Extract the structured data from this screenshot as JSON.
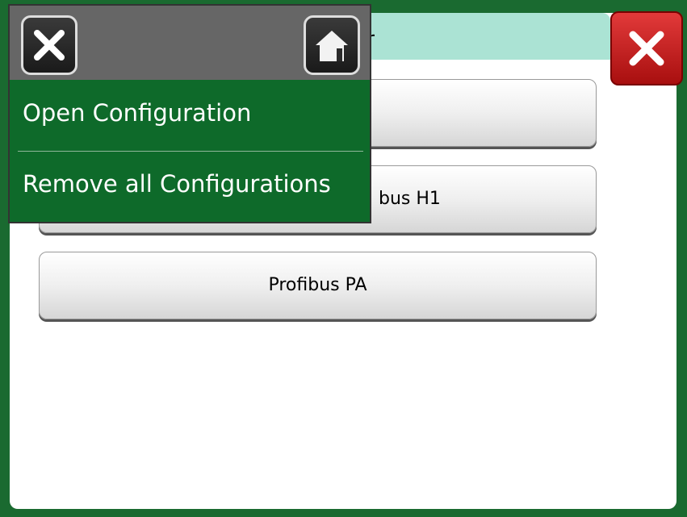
{
  "window": {
    "title_visible": "tor",
    "close_icon": "close-icon"
  },
  "main": {
    "buttons": [
      {
        "label": ""
      },
      {
        "label": "bus H1"
      },
      {
        "label": "Profibus PA"
      }
    ]
  },
  "menu": {
    "close_icon": "close-icon",
    "home_icon": "home-icon",
    "items": [
      {
        "label": "Open Configuration"
      },
      {
        "label": "Remove all Configurations"
      }
    ]
  },
  "colors": {
    "frame_green": "#1a6a30",
    "menu_green": "#0e6a2a",
    "title_bar": "#abe3d4",
    "close_red": "#d42020"
  }
}
